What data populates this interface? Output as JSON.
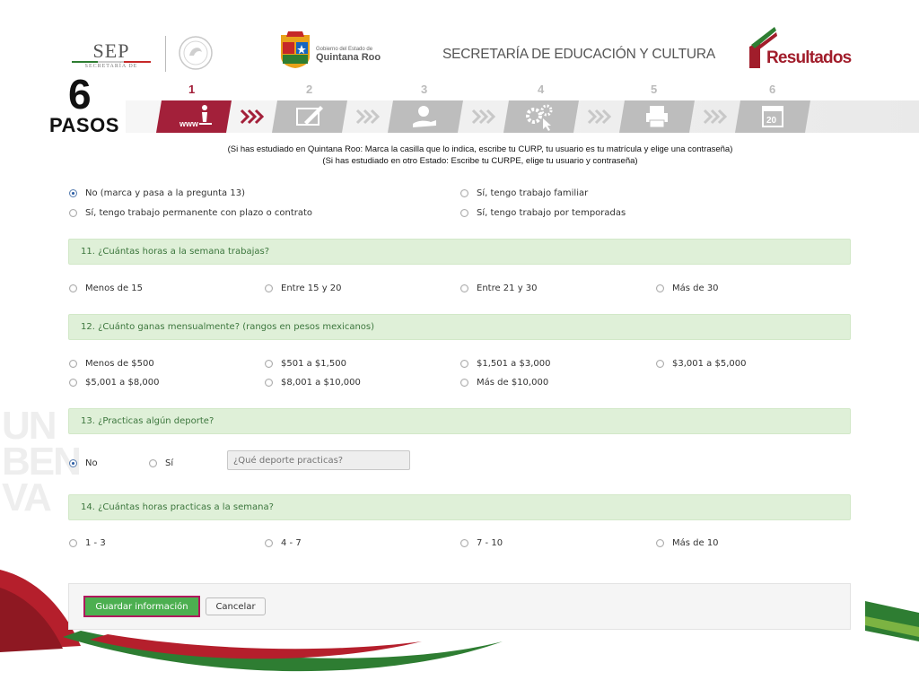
{
  "header": {
    "sep": {
      "name": "SEP",
      "sub": "SECRETARÍA DE"
    },
    "quintana_roo": {
      "small": "Gobierno del Estado de",
      "big": "Quintana Roo"
    },
    "secretaria_title": "SECRETARÍA DE EDUCACIÓN Y CULTURA",
    "resultados_logo": "Resultados"
  },
  "steps": {
    "big_number": "6",
    "label": "PASOS",
    "active_step": 1,
    "items": [
      {
        "number": "1",
        "icon": "www-person-icon"
      },
      {
        "number": "2",
        "icon": "form-edit-icon"
      },
      {
        "number": "3",
        "icon": "hand-money-icon"
      },
      {
        "number": "4",
        "icon": "gears-cursor-icon"
      },
      {
        "number": "5",
        "icon": "printer-icon"
      },
      {
        "number": "6",
        "icon": "calendar-20-icon"
      }
    ],
    "instructions": [
      "(Si has estudiado en Quintana Roo: Marca la casilla que lo indica, escribe tu CURP,  tu usuario es tu matrícula y elige una contraseña)",
      "(Si has estudiado en otro Estado: Escribe tu CURPE, elige tu usuario y contraseña)"
    ]
  },
  "q10": {
    "options": [
      "No (marca y pasa a la pregunta 13)",
      "Sí, tengo trabajo familiar",
      "Sí, tengo trabajo permanente con plazo o contrato",
      "Sí, tengo trabajo por temporadas"
    ],
    "selected": 0
  },
  "q11": {
    "question": "11. ¿Cuántas horas a la semana trabajas?",
    "options": [
      "Menos de 15",
      "Entre 15 y 20",
      "Entre 21 y 30",
      "Más de 30"
    ]
  },
  "q12": {
    "question": "12. ¿Cuánto ganas mensualmente? (rangos en pesos mexicanos)",
    "options": [
      "Menos de $500",
      "$501 a $1,500",
      "$1,501 a $3,000",
      "$3,001 a $5,000",
      "$5,001 a $8,000",
      "$8,001 a $10,000",
      "Más de $10,000"
    ]
  },
  "q13": {
    "question": "13. ¿Practicas algún deporte?",
    "options": [
      "No",
      "Sí"
    ],
    "selected": 0,
    "sport_placeholder": "¿Qué deporte practicas?"
  },
  "q14": {
    "question": "14. ¿Cuántas horas practicas a la semana?",
    "options": [
      "1 - 3",
      "4 - 7",
      "7 - 10",
      "Más de 10"
    ]
  },
  "actions": {
    "save_label": "Guardar información",
    "cancel_label": "Cancelar"
  },
  "colors": {
    "accent": "#a3203a",
    "green_bar": "#dff0d8",
    "green_text": "#3c763d",
    "save_button": "#4caf50",
    "save_border": "#b0175d"
  }
}
